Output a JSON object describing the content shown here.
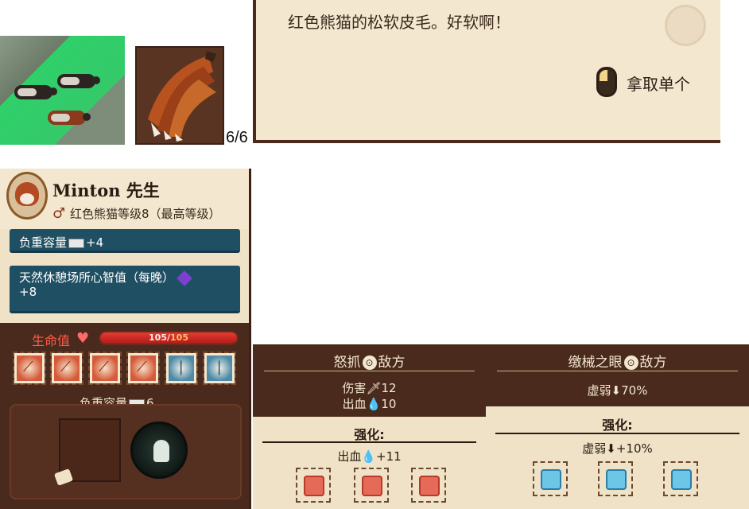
{
  "thumbnails": {
    "stack_count": "6/6"
  },
  "tooltip": {
    "description": "红色熊猫的松软皮毛。好软啊！",
    "action_label": "拿取单个"
  },
  "character": {
    "name": "Minton 先生",
    "gender_icon": "male-icon",
    "species_level": "红色熊猫等级8（最高等级）",
    "traits": [
      {
        "label": "负重容量",
        "icon": "cube-icon",
        "value": "+4"
      },
      {
        "label": "天然休憩场所心智值（每晚）",
        "icon": "gem-icon",
        "value": "+8"
      }
    ],
    "health": {
      "label": "生命值",
      "current": "105",
      "max": "105",
      "fraction": 1.0
    },
    "slots": [
      {
        "type": "red",
        "icon": "claw-icon"
      },
      {
        "type": "red",
        "icon": "claw-icon"
      },
      {
        "type": "red",
        "icon": "claw-icon"
      },
      {
        "type": "red",
        "icon": "claw-icon"
      },
      {
        "type": "blue",
        "icon": "eye-icon"
      },
      {
        "type": "blue",
        "icon": "eye-icon"
      }
    ],
    "capacity": {
      "label": "负重容量",
      "value": "6"
    }
  },
  "skills": [
    {
      "name": "怒抓",
      "target": "敌方",
      "stats": [
        {
          "label": "伤害",
          "value": "12"
        },
        {
          "label": "出血",
          "value": "10"
        }
      ],
      "enhance_label": "强化:",
      "enhance": {
        "label": "出血",
        "value": "+11"
      },
      "gem_color": "#e56a58"
    },
    {
      "name": "缴械之眼",
      "target": "敌方",
      "stats": [
        {
          "label": "虚弱",
          "value": "70%"
        }
      ],
      "enhance_label": "强化:",
      "enhance": {
        "label": "虚弱",
        "value": "+10%"
      },
      "gem_color": "#6ec6e6"
    }
  ]
}
